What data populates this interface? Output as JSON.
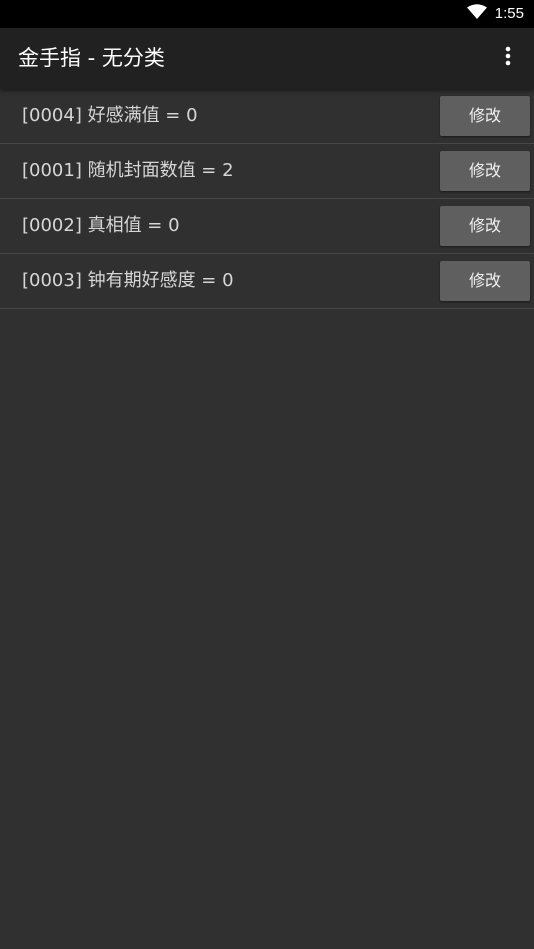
{
  "status_bar": {
    "time": "1:55",
    "icons": [
      "wifi-icon",
      "battery-icon"
    ]
  },
  "app_bar": {
    "title": "金手指 - 无分类",
    "menu_icon": "overflow-menu-icon"
  },
  "cheats": [
    {
      "label": "[0004] 好感满值 = 0",
      "button": "修改"
    },
    {
      "label": "[0001] 随机封面数值 = 2",
      "button": "修改"
    },
    {
      "label": "[0002] 真相值 = 0",
      "button": "修改"
    },
    {
      "label": "[0003] 钟有期好感度 = 0",
      "button": "修改"
    }
  ],
  "colors": {
    "background": "#303030",
    "app_bar": "#212121",
    "status_bar": "#000000",
    "button": "#5f5f5f",
    "divider": "#474747"
  }
}
